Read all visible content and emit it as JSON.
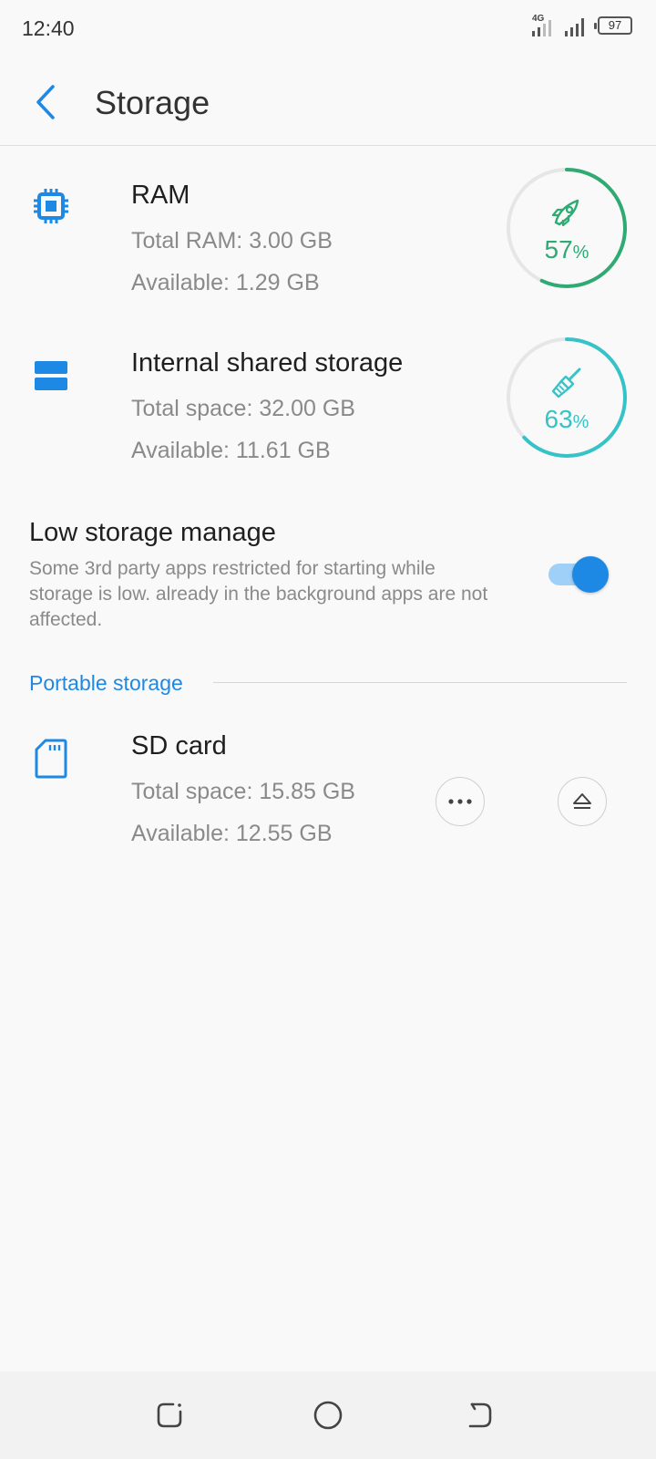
{
  "status_bar": {
    "time": "12:40",
    "network": "4G",
    "battery": "97"
  },
  "app_bar": {
    "title": "Storage"
  },
  "ram": {
    "title": "RAM",
    "total": "Total RAM: 3.00 GB",
    "available": "Available: 1.29 GB",
    "usage_value": "57",
    "usage_fraction": 0.57,
    "color": "#2eaa72"
  },
  "internal": {
    "title": "Internal shared storage",
    "total": "Total space: 32.00 GB",
    "available": "Available: 11.61 GB",
    "usage_value": "63",
    "usage_fraction": 0.63,
    "color": "#36c3c8"
  },
  "percent_sign": "%",
  "low_storage": {
    "title": "Low storage manage",
    "description": "Some 3rd party apps restricted for starting while storage is low. already in the background apps are not affected.",
    "enabled": true
  },
  "portable_section": {
    "label": "Portable storage"
  },
  "sd_card": {
    "title": "SD card",
    "total": "Total space: 15.85 GB",
    "available": "Available: 12.55 GB"
  },
  "colors": {
    "accent": "#1e88e5",
    "divider": "#dedede",
    "secondary_text": "#8a8a8a"
  },
  "icons": {
    "back": "chevron-left-icon",
    "ram": "chip-icon",
    "internal": "storage-icon",
    "ram_ring": "rocket-icon",
    "internal_ring": "broom-icon",
    "sd": "sd-card-icon",
    "more": "more-horizontal-icon",
    "eject": "eject-icon"
  }
}
